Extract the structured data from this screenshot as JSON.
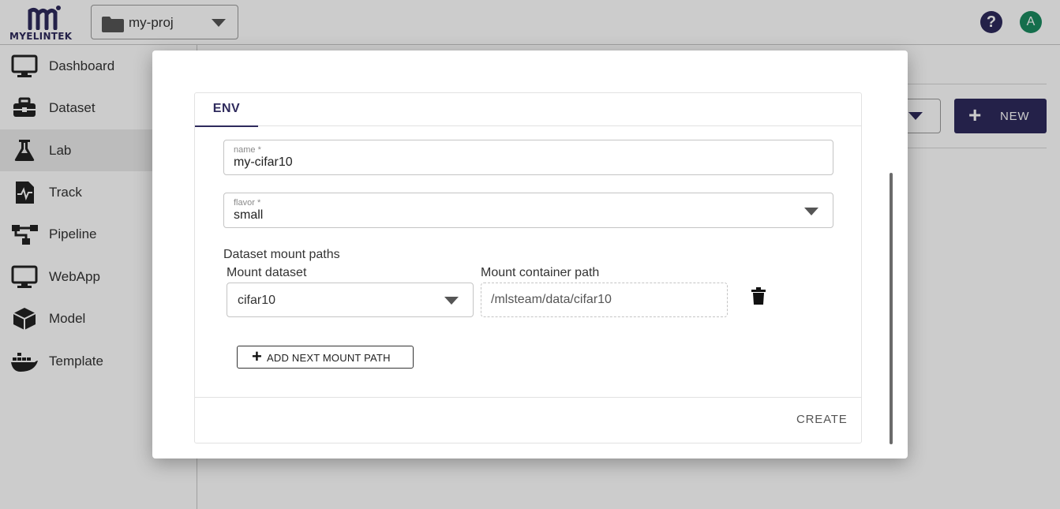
{
  "header": {
    "logo_text": "MYELINTEK",
    "project": "my-proj",
    "help_icon": "?",
    "avatar_initial": "A"
  },
  "sidebar": {
    "items": [
      {
        "label": "Dashboard",
        "icon": "monitor-icon"
      },
      {
        "label": "Dataset",
        "icon": "toolbox-icon"
      },
      {
        "label": "Lab",
        "icon": "flask-icon",
        "active": true
      },
      {
        "label": "Track",
        "icon": "document-chart-icon"
      },
      {
        "label": "Pipeline",
        "icon": "pipeline-icon"
      },
      {
        "label": "WebApp",
        "icon": "monitor-icon"
      },
      {
        "label": "Model",
        "icon": "cube-icon"
      },
      {
        "label": "Template",
        "icon": "docker-icon"
      }
    ]
  },
  "main": {
    "new_button": "NEW"
  },
  "modal": {
    "tab": "ENV",
    "name_field": {
      "label": "name *",
      "value": "my-cifar10"
    },
    "flavor_field": {
      "label": "flavor *",
      "value": "small"
    },
    "mount_section_title": "Dataset mount paths",
    "mount_dataset_label": "Mount dataset",
    "mount_container_label": "Mount container path",
    "mount_dataset_value": "cifar10",
    "mount_container_value": "/mlsteam/data/cifar10",
    "add_mount_button": "ADD NEXT MOUNT PATH",
    "create_button": "CREATE"
  },
  "colors": {
    "brand": "#2e2a5c",
    "avatar": "#1b8a5f"
  }
}
